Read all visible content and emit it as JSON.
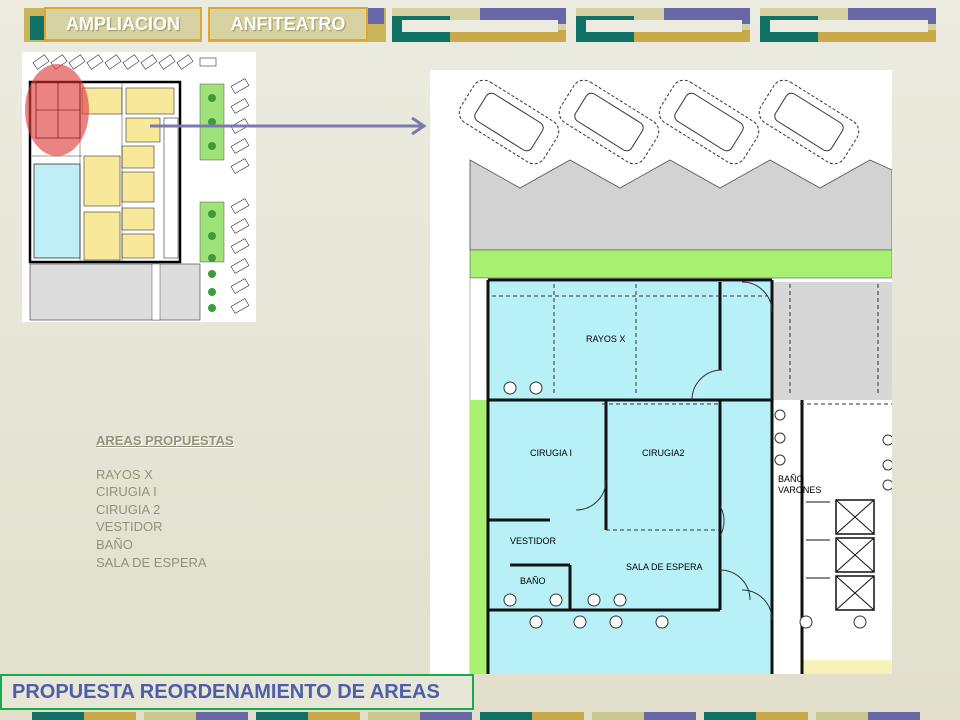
{
  "tabs": [
    {
      "label": "AMPLIACION"
    },
    {
      "label": "ANFITEATRO"
    }
  ],
  "legend": {
    "heading": "AREAS PROPUESTAS",
    "items": [
      "RAYOS X",
      "CIRUGIA I",
      "CIRUGIA 2",
      "VESTIDOR",
      "BAÑO",
      "SALA DE ESPERA"
    ]
  },
  "plan": {
    "rooms": {
      "rayos": "RAYOS X",
      "cirugia1": "CIRUGIA I",
      "cirugia2": "CIRUGIA2",
      "vestidor": "VESTIDOR",
      "bano": "BAÑO",
      "sala": "SALA DE ESPERA",
      "bano_varones": "BAÑO\nVARONES"
    }
  },
  "footer": {
    "title": "PROPUESTA REORDENAMIENTO DE AREAS"
  },
  "colors": {
    "room_fill": "#b7f1f7",
    "green_strip": "#a8f070",
    "highlight": "#e04040",
    "arrow": "#7a7ab0",
    "footer_border": "#1aa84f",
    "footer_text": "#4b5faa"
  }
}
